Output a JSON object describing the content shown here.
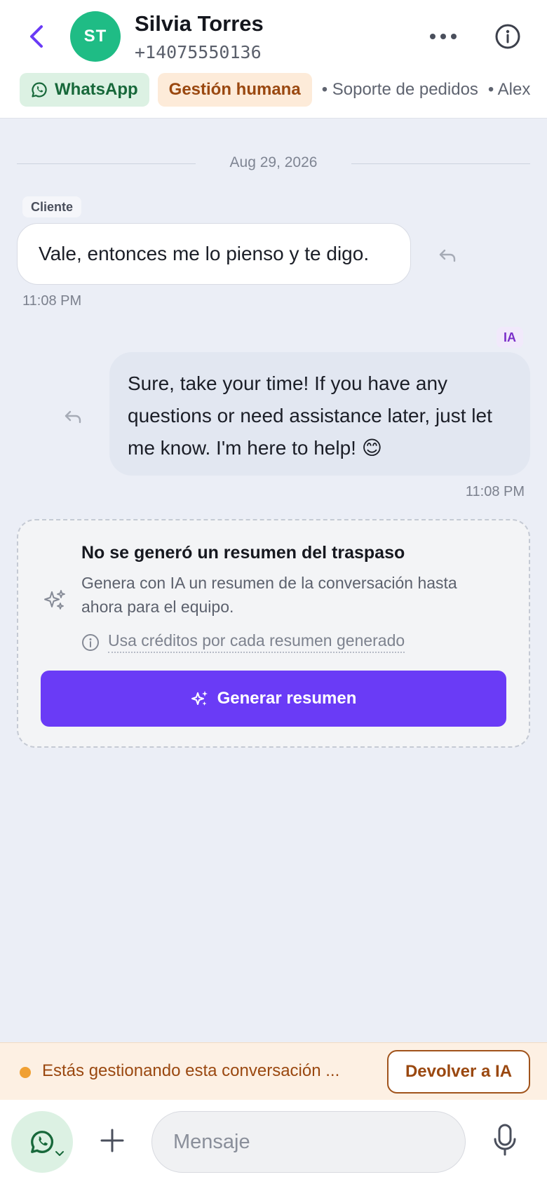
{
  "header": {
    "avatar_initials": "ST",
    "contact_name": "Silvia Torres",
    "contact_phone": "+14075550136",
    "channel_chip": "WhatsApp",
    "status_chip": "Gestión humana",
    "queue": "• Soporte de pedidos",
    "agent": "• Alex"
  },
  "chat": {
    "date": "Aug 29, 2026",
    "messages": [
      {
        "sender_tag": "Cliente",
        "text": "Vale, entonces me lo pienso y te digo.",
        "time": "11:08 PM"
      },
      {
        "sender_tag": "IA",
        "text": "Sure, take your time! If you have any questions or need assistance later, just let me know. I'm here to help! 😊",
        "time": "11:08 PM"
      }
    ]
  },
  "summary": {
    "title": "No se generó un resumen del traspaso",
    "description": "Genera con IA un resumen de la conversación hasta ahora para el equipo.",
    "credits_note": "Usa créditos por cada resumen generado",
    "button_label": "Generar resumen"
  },
  "status_bar": {
    "text": "Estás gestionando esta conversación ...",
    "return_button": "Devolver a IA"
  },
  "composer": {
    "placeholder": "Mensaje"
  },
  "colors": {
    "accent": "#6a3bf6",
    "whatsapp_green": "#1fbc85",
    "human_orange": "#9a4810",
    "background": "#ebeef6"
  }
}
